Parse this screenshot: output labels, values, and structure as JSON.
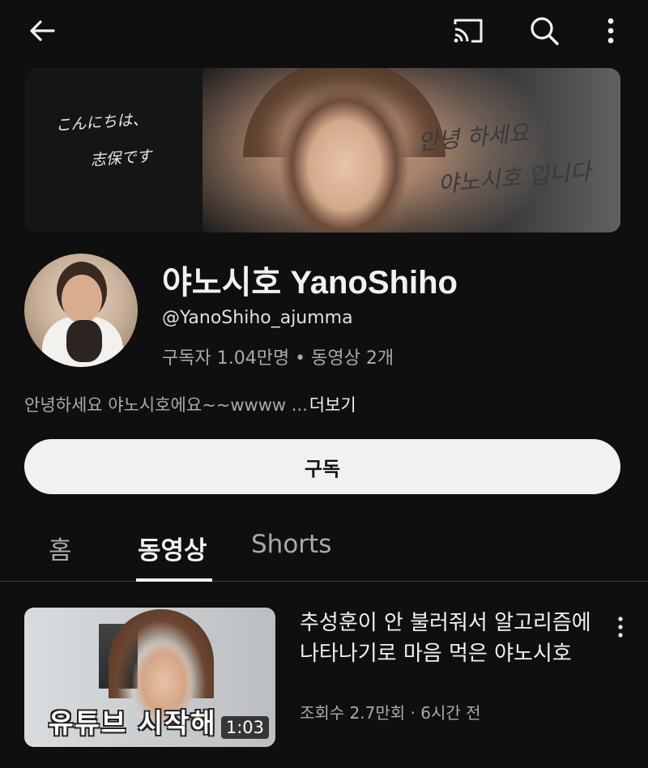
{
  "topbar": {
    "back_icon": "arrow-left-icon",
    "cast_icon": "cast-icon",
    "search_icon": "search-icon",
    "more_icon": "more-vertical-icon"
  },
  "banner": {
    "text_left_line1": "こんにちは、",
    "text_left_line2": "志保です",
    "text_right_line1": "안녕 하세요",
    "text_right_line2": "야노시호 입니다"
  },
  "channel": {
    "title": "야노시호 YanoShiho",
    "handle": "@YanoShiho_ajumma",
    "stats": "구독자 1.04만명 • 동영상 2개",
    "description": "안녕하세요 야노시호에요~~wwww ...",
    "more_label": "더보기"
  },
  "subscribe_label": "구독",
  "tabs": [
    {
      "label": "홈"
    },
    {
      "label": "동영상"
    },
    {
      "label": "Shorts"
    }
  ],
  "videos": [
    {
      "title": "추성훈이 안 불러줘서 알고리즘에 나타나기로 마음 먹은 야노시호",
      "meta": "조회수 2.7만회 · 6시간 전",
      "duration": "1:03",
      "thumbnail_caption": "유튜브 시작해"
    }
  ]
}
